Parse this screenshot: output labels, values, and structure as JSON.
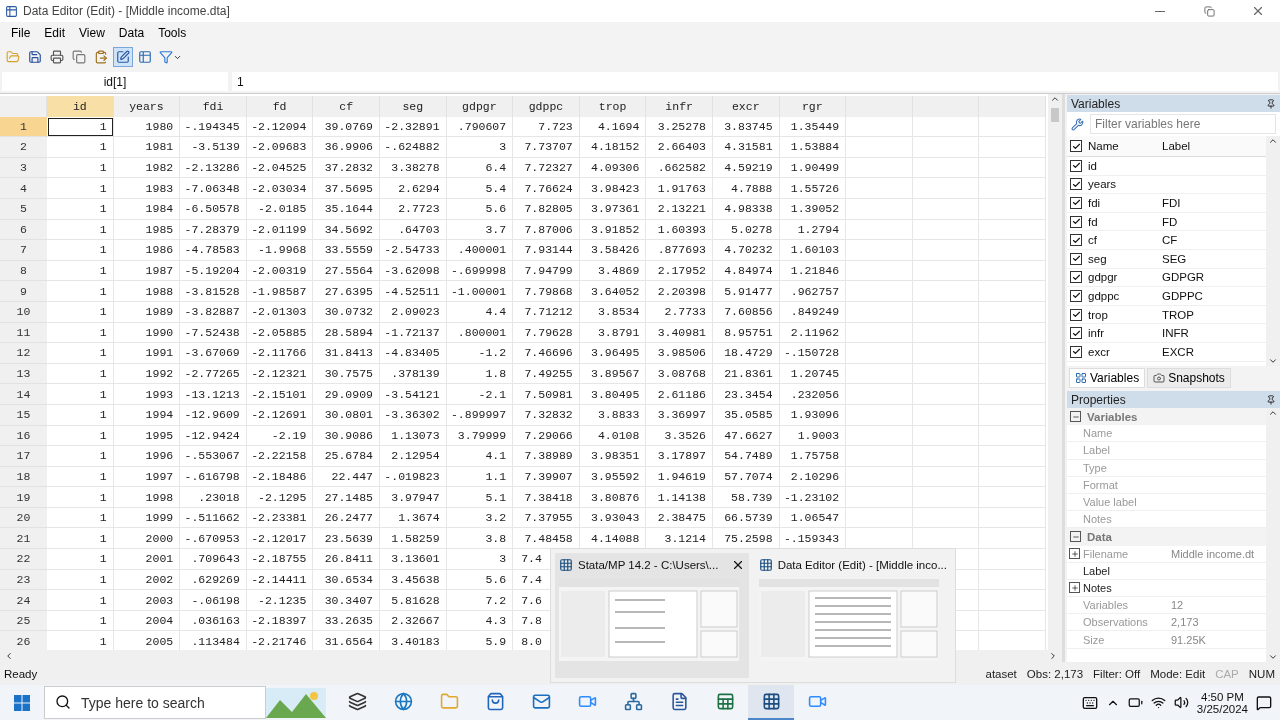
{
  "window": {
    "title": "Data Editor (Edit) - [Middle income.dta]"
  },
  "menu": [
    "File",
    "Edit",
    "View",
    "Data",
    "Tools"
  ],
  "toolbar": [
    {
      "kind": "open",
      "selected": false
    },
    {
      "kind": "save",
      "selected": false
    },
    {
      "kind": "print",
      "selected": false
    },
    {
      "kind": "copy",
      "selected": false
    },
    {
      "kind": "paste",
      "selected": false
    },
    {
      "kind": "edit",
      "selected": true
    },
    {
      "kind": "browse",
      "selected": false
    },
    {
      "kind": "filter",
      "selected": false
    }
  ],
  "cell_bar": {
    "name": "id[1]",
    "value": "1"
  },
  "table": {
    "columns": [
      {
        "label": "id",
        "selected": true
      },
      {
        "label": "years",
        "selected": false
      },
      {
        "label": "fdi",
        "selected": false
      },
      {
        "label": "fd",
        "selected": false
      },
      {
        "label": "cf",
        "selected": false
      },
      {
        "label": "seg",
        "selected": false
      },
      {
        "label": "gdpgr",
        "selected": false
      },
      {
        "label": "gdppc",
        "selected": false
      },
      {
        "label": "trop",
        "selected": false
      },
      {
        "label": "infr",
        "selected": false
      },
      {
        "label": "excr",
        "selected": false
      },
      {
        "label": "rgr",
        "selected": false
      }
    ],
    "rows": [
      {
        "number": "1",
        "selected": true,
        "cells": [
          "1",
          "1980",
          "-.194345",
          "-2.12094",
          "39.0769",
          "-2.32891",
          ".790607",
          "7.723",
          "4.1694",
          "3.25278",
          "3.83745",
          "1.35449"
        ]
      },
      {
        "number": "2",
        "selected": false,
        "cells": [
          "1",
          "1981",
          "-3.5139",
          "-2.09683",
          "36.9906",
          "-.624882",
          "3",
          "7.73707",
          "4.18152",
          "2.66403",
          "4.31581",
          "1.53884"
        ]
      },
      {
        "number": "3",
        "selected": false,
        "cells": [
          "1",
          "1982",
          "-2.13286",
          "-2.04525",
          "37.2832",
          "3.38278",
          "6.4",
          "7.72327",
          "4.09306",
          ".662582",
          "4.59219",
          "1.90499"
        ]
      },
      {
        "number": "4",
        "selected": false,
        "cells": [
          "1",
          "1983",
          "-7.06348",
          "-2.03034",
          "37.5695",
          "2.6294",
          "5.4",
          "7.76624",
          "3.98423",
          "1.91763",
          "4.7888",
          "1.55726"
        ]
      },
      {
        "number": "5",
        "selected": false,
        "cells": [
          "1",
          "1984",
          "-6.50578",
          "-2.0185",
          "35.1644",
          "2.7723",
          "5.6",
          "7.82805",
          "3.97361",
          "2.13221",
          "4.98338",
          "1.39052"
        ]
      },
      {
        "number": "6",
        "selected": false,
        "cells": [
          "1",
          "1985",
          "-7.28379",
          "-2.01199",
          "34.5692",
          ".64703",
          "3.7",
          "7.87006",
          "3.91852",
          "1.60393",
          "5.0278",
          "1.2794"
        ]
      },
      {
        "number": "7",
        "selected": false,
        "cells": [
          "1",
          "1986",
          "-4.78583",
          "-1.9968",
          "33.5559",
          "-2.54733",
          ".400001",
          "7.93144",
          "3.58426",
          ".877693",
          "4.70232",
          "1.60103"
        ]
      },
      {
        "number": "8",
        "selected": false,
        "cells": [
          "1",
          "1987",
          "-5.19204",
          "-2.00319",
          "27.5564",
          "-3.62098",
          "-.699998",
          "7.94799",
          "3.4869",
          "2.17952",
          "4.84974",
          "1.21846"
        ]
      },
      {
        "number": "9",
        "selected": false,
        "cells": [
          "1",
          "1988",
          "-3.81528",
          "-1.98587",
          "27.6395",
          "-4.52511",
          "-1.00001",
          "7.79868",
          "3.64052",
          "2.20398",
          "5.91477",
          ".962757"
        ]
      },
      {
        "number": "10",
        "selected": false,
        "cells": [
          "1",
          "1989",
          "-3.82887",
          "-2.01303",
          "30.0732",
          "2.09023",
          "4.4",
          "7.71212",
          "3.8534",
          "2.7733",
          "7.60856",
          ".849249"
        ]
      },
      {
        "number": "11",
        "selected": false,
        "cells": [
          "1",
          "1990",
          "-7.52438",
          "-2.05885",
          "28.5894",
          "-1.72137",
          ".800001",
          "7.79628",
          "3.8791",
          "3.40981",
          "8.95751",
          "2.11962"
        ]
      },
      {
        "number": "12",
        "selected": false,
        "cells": [
          "1",
          "1991",
          "-3.67069",
          "-2.11766",
          "31.8413",
          "-4.83405",
          "-1.2",
          "7.46696",
          "3.96495",
          "3.98506",
          "18.4729",
          "-.150728"
        ]
      },
      {
        "number": "13",
        "selected": false,
        "cells": [
          "1",
          "1992",
          "-2.77265",
          "-2.12321",
          "30.7575",
          ".378139",
          "1.8",
          "7.49255",
          "3.89567",
          "3.08768",
          "21.8361",
          "1.20745"
        ]
      },
      {
        "number": "14",
        "selected": false,
        "cells": [
          "1",
          "1993",
          "-13.1213",
          "-2.15101",
          "29.0909",
          "-3.54121",
          "-2.1",
          "7.50981",
          "3.80495",
          "2.61186",
          "23.3454",
          ".232056"
        ]
      },
      {
        "number": "15",
        "selected": false,
        "cells": [
          "1",
          "1994",
          "-12.9609",
          "-2.12691",
          "30.0801",
          "-3.36302",
          "-.899997",
          "7.32832",
          "3.8833",
          "3.36997",
          "35.0585",
          "1.93096"
        ]
      },
      {
        "number": "16",
        "selected": false,
        "cells": [
          "1",
          "1995",
          "-12.9424",
          "-2.19",
          "30.9086",
          "1.13073",
          "3.79999",
          "7.29066",
          "4.0108",
          "3.3526",
          "47.6627",
          "1.9003"
        ]
      },
      {
        "number": "17",
        "selected": false,
        "cells": [
          "1",
          "1996",
          "-.553067",
          "-2.22158",
          "25.6784",
          "2.12954",
          "4.1",
          "7.38989",
          "3.98351",
          "3.17897",
          "54.7489",
          "1.75758"
        ]
      },
      {
        "number": "18",
        "selected": false,
        "cells": [
          "1",
          "1997",
          "-.616798",
          "-2.18486",
          "22.447",
          "-.019823",
          "1.1",
          "7.39907",
          "3.95592",
          "1.94619",
          "57.7074",
          "2.10296"
        ]
      },
      {
        "number": "19",
        "selected": false,
        "cells": [
          "1",
          "1998",
          ".23018",
          "-2.1295",
          "27.1485",
          "3.97947",
          "5.1",
          "7.38418",
          "3.80876",
          "1.14138",
          "58.739",
          "-1.23102"
        ]
      },
      {
        "number": "20",
        "selected": false,
        "cells": [
          "1",
          "1999",
          "-.511662",
          "-2.23381",
          "26.2477",
          "1.3674",
          "3.2",
          "7.37955",
          "3.93043",
          "2.38475",
          "66.5739",
          "1.06547"
        ]
      },
      {
        "number": "21",
        "selected": false,
        "cells": [
          "1",
          "2000",
          "-.670953",
          "-2.12017",
          "23.5639",
          "1.58259",
          "3.8",
          "7.48458",
          "4.14088",
          "3.1214",
          "75.2598",
          "-.159343"
        ]
      },
      {
        "number": "22",
        "selected": false,
        "cut_off": true,
        "cells": [
          "1",
          "2001",
          ".709643",
          "-2.18755",
          "26.8411",
          "3.13601",
          "3",
          "7.4"
        ]
      },
      {
        "number": "23",
        "selected": false,
        "cut_off": true,
        "cells": [
          "1",
          "2002",
          ".629269",
          "-2.14411",
          "30.6534",
          "3.45638",
          "5.6",
          "7.4"
        ]
      },
      {
        "number": "24",
        "selected": false,
        "cut_off": true,
        "cells": [
          "1",
          "2003",
          "-.06198",
          "-2.1235",
          "30.3407",
          "5.81628",
          "7.2",
          "7.6"
        ]
      },
      {
        "number": "25",
        "selected": false,
        "cut_off": true,
        "cells": [
          "1",
          "2004",
          ".036163",
          "-2.18397",
          "33.2635",
          "2.32667",
          "4.3",
          "7.8"
        ]
      },
      {
        "number": "26",
        "selected": false,
        "cut_off": true,
        "cells": [
          "1",
          "2005",
          ".113484",
          "-2.21746",
          "31.6564",
          "3.40183",
          "5.9",
          "8.0"
        ]
      }
    ]
  },
  "variables_panel": {
    "title": "Variables",
    "filter_placeholder": "Filter variables here",
    "all_checked": true,
    "columns": [
      "Name",
      "Label"
    ],
    "items": [
      {
        "name": "id",
        "checked": true
      },
      {
        "name": "years",
        "checked": true
      },
      {
        "name": "fdi",
        "label": "FDI",
        "checked": true
      },
      {
        "name": "fd",
        "label": "FD",
        "checked": true
      },
      {
        "name": "cf",
        "label": "CF",
        "checked": true
      },
      {
        "name": "seg",
        "label": "SEG",
        "checked": true
      },
      {
        "name": "gdpgr",
        "label": "GDPGR",
        "checked": true
      },
      {
        "name": "gdppc",
        "label": "GDPPC",
        "checked": true
      },
      {
        "name": "trop",
        "label": "TROP",
        "checked": true
      },
      {
        "name": "infr",
        "label": "INFR",
        "checked": true
      },
      {
        "name": "excr",
        "label": "EXCR",
        "checked": true
      }
    ],
    "tabs": [
      {
        "label": "Variables",
        "selected": true
      },
      {
        "label": "Snapshots",
        "selected": false
      }
    ]
  },
  "properties_panel": {
    "title": "Properties",
    "groups": [
      {
        "title": "Variables",
        "expanded": true,
        "rows": [
          {
            "name": "Name",
            "disabled": true
          },
          {
            "name": "Label",
            "disabled": true
          },
          {
            "name": "Type",
            "disabled": true
          },
          {
            "name": "Format",
            "disabled": true
          },
          {
            "name": "Value label",
            "disabled": true
          },
          {
            "name": "Notes",
            "disabled": true
          }
        ]
      },
      {
        "title": "Data",
        "expanded": true,
        "rows": [
          {
            "name": "Filename",
            "value": "Middle income.dt",
            "disabled": true,
            "expandable": true
          },
          {
            "name": "Label",
            "disabled": false
          },
          {
            "name": "Notes",
            "disabled": false,
            "expandable": true
          },
          {
            "name": "Variables",
            "value": "12",
            "disabled": true
          },
          {
            "name": "Observations",
            "value": "2,173",
            "disabled": true
          },
          {
            "name": "Size",
            "value": "91.25K",
            "disabled": true
          }
        ]
      }
    ]
  },
  "status_bar": {
    "message": "Ready",
    "items": [
      {
        "text": "ataset",
        "disabled": false
      },
      {
        "text": "Obs: 2,173",
        "disabled": false
      },
      {
        "text": "Filter: Off",
        "disabled": false
      },
      {
        "text": "Mode: Edit",
        "disabled": false
      },
      {
        "text": "CAP",
        "disabled": true
      },
      {
        "text": "NUM",
        "disabled": false
      }
    ]
  },
  "taskbar_preview": {
    "windows": [
      {
        "title": "Stata/MP 14.2 - C:\\Users\\...",
        "hovered": true
      },
      {
        "title": "Data Editor (Edit) - [Middle inco...",
        "hovered": false
      }
    ]
  },
  "taskbar": {
    "search_placeholder": "Type here to search",
    "apps": [
      {
        "kind": "task-view",
        "selected": false
      },
      {
        "kind": "browser",
        "selected": false
      },
      {
        "kind": "folder",
        "selected": false
      },
      {
        "kind": "store",
        "selected": false
      },
      {
        "kind": "mail",
        "selected": false
      },
      {
        "kind": "video",
        "selected": false
      },
      {
        "kind": "network",
        "selected": false
      },
      {
        "kind": "word",
        "selected": false
      },
      {
        "kind": "excel",
        "selected": false
      },
      {
        "kind": "table",
        "selected": true
      },
      {
        "kind": "video",
        "selected": false
      }
    ],
    "time": "4:50 PM",
    "date": "3/25/2024"
  }
}
